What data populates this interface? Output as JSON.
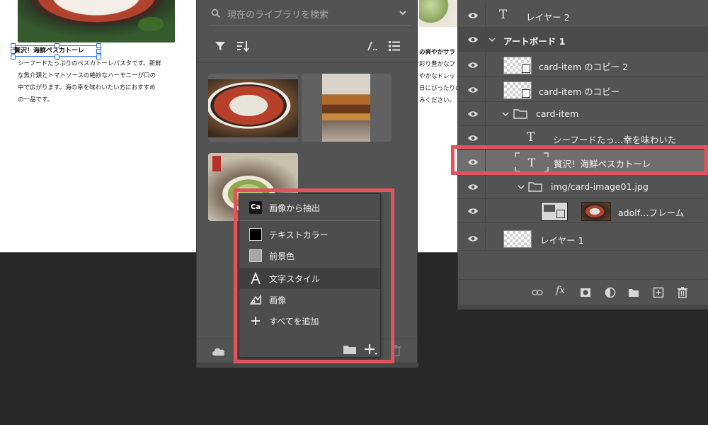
{
  "canvas": {
    "selected_title": "贅沢！海鮮ペスカトーレ",
    "body_lines": [
      "シーフードたっぷりのペスカトーレパスタです。新鮮",
      "な魚介類とトマトソースの絶妙なハーモニーが口の",
      "中で広がります。海の幸を味わいたい方におすすめ",
      "の一品です。"
    ],
    "right_title": "の爽やかサラ",
    "right_lines": [
      "彩り豊かなフ",
      "やかなドレッ",
      "日にぴったりの",
      "みください。"
    ]
  },
  "library": {
    "search_placeholder": "現在のライブラリを検索",
    "toolbar_icons": [
      "filter-icon",
      "sort-icon",
      "view-grid-icon",
      "view-list-icon"
    ]
  },
  "menu": {
    "items": [
      {
        "label": "画像から抽出",
        "icon": "ca-icon"
      },
      {
        "label": "テキストカラー",
        "icon": "swatch-black",
        "color": "#000000"
      },
      {
        "label": "前景色",
        "icon": "swatch-gray",
        "color": "#a6a6a6"
      },
      {
        "label": "文字スタイル",
        "icon": "character-style-icon"
      },
      {
        "label": "画像",
        "icon": "image-icon"
      },
      {
        "label": "すべてを追加",
        "icon": "plus-icon"
      }
    ],
    "ca_text": "Ca",
    "highlighted_index": 3
  },
  "layers": {
    "rows": [
      {
        "label": "レイヤー 2"
      },
      {
        "label": "アートボード 1"
      },
      {
        "label": "card-item のコピー 2"
      },
      {
        "label": "card-item のコピー"
      },
      {
        "label": "card-item"
      },
      {
        "label": "シーフードたっ…幸を味わいた"
      },
      {
        "label": "贅沢！海鮮ペスカトーレ"
      },
      {
        "label": "img/card-image01.jpg"
      },
      {
        "label": "adolf…フレーム"
      },
      {
        "label": "レイヤー 1"
      }
    ],
    "selected_index": 6,
    "footer_icons": [
      "link-icon",
      "fx-icon",
      "mask-icon",
      "adjustment-icon",
      "group-folder-icon",
      "new-layer-icon",
      "delete-icon"
    ],
    "fx_text": "fx"
  },
  "colors": {
    "highlight_red": "#e5525b",
    "panel_bg": "#535353",
    "app_bg": "#282828",
    "selection_blue": "#2f6cf6"
  }
}
